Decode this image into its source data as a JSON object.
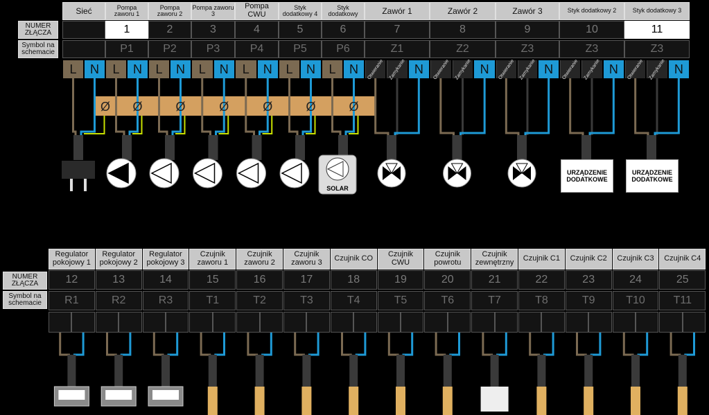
{
  "top": {
    "row_label_number": "NUMER ZŁĄCZA",
    "row_label_symbol": "Symbol na schemacie",
    "columns": [
      {
        "header": "Sieć",
        "number": "",
        "symbol": "",
        "terminals": [
          "L",
          "N"
        ]
      },
      {
        "header": "Pompa zaworu 1",
        "number": "1",
        "symbol": "P1",
        "terminals": [
          "L",
          "N"
        ]
      },
      {
        "header": "Pompa zaworu 2",
        "number": "2",
        "symbol": "P2",
        "terminals": [
          "L",
          "N"
        ]
      },
      {
        "header": "Pompa zaworu 3",
        "number": "3",
        "symbol": "P3",
        "terminals": [
          "L",
          "N"
        ]
      },
      {
        "header": "Pompa CWU",
        "number": "4",
        "symbol": "P4",
        "terminals": [
          "L",
          "N"
        ]
      },
      {
        "header": "Styk dodatkowy 4",
        "number": "5",
        "symbol": "P5",
        "terminals": [
          "L",
          "N"
        ]
      },
      {
        "header": "Styk dodatkowy",
        "number": "6",
        "symbol": "P6",
        "terminals": [
          "L",
          "N"
        ]
      },
      {
        "header": "Zawór 1",
        "number": "7",
        "symbol": "Z1",
        "terminals": [
          "Otwieranie",
          "Zamykanie",
          "N"
        ]
      },
      {
        "header": "Zawór 2",
        "number": "8",
        "symbol": "Z2",
        "terminals": [
          "Otwieranie",
          "Zamykanie",
          "N"
        ]
      },
      {
        "header": "Zawór 3",
        "number": "9",
        "symbol": "Z3",
        "terminals": [
          "Otwieranie",
          "Zamykanie",
          "N"
        ]
      },
      {
        "header": "Styk dodatkowy 2",
        "number": "10",
        "symbol": "Z3",
        "terminals": [
          "Otwieranie",
          "Zamykanie",
          "N"
        ]
      },
      {
        "header": "Styk dodatkowy 3",
        "number": "11",
        "symbol": "Z3",
        "terminals": [
          "Otwieranie",
          "Zamykanie",
          "N"
        ]
      }
    ],
    "highlighted_numbers": [
      "1",
      "11"
    ],
    "fuse_symbol": "Ø",
    "devices": [
      {
        "kind": "plug-icon"
      },
      {
        "kind": "pump-icon"
      },
      {
        "kind": "pump-icon"
      },
      {
        "kind": "pump-icon"
      },
      {
        "kind": "pump-icon"
      },
      {
        "kind": "pump-icon"
      },
      {
        "kind": "solar-pump-icon",
        "label": "SOLAR"
      },
      {
        "kind": "valve-icon"
      },
      {
        "kind": "valve-icon"
      },
      {
        "kind": "valve-icon"
      },
      {
        "kind": "device-box",
        "label": "URZĄDZENIE DODATKOWE"
      },
      {
        "kind": "device-box",
        "label": "URZĄDZENIE DODATKOWE"
      }
    ]
  },
  "bottom": {
    "row_label_number": "NUMER ZŁĄCZA",
    "row_label_symbol": "Symbol na schemacie",
    "columns": [
      {
        "header": "Regulator pokojowy 1",
        "number": "12",
        "symbol": "R1",
        "device": "room-regulator"
      },
      {
        "header": "Regulator pokojowy 2",
        "number": "13",
        "symbol": "R2",
        "device": "room-regulator"
      },
      {
        "header": "Regulator pokojowy 3",
        "number": "14",
        "symbol": "R3",
        "device": "room-regulator"
      },
      {
        "header": "Czujnik zaworu 1",
        "number": "15",
        "symbol": "T1",
        "device": "temp-sensor"
      },
      {
        "header": "Czujnik zaworu 2",
        "number": "16",
        "symbol": "T2",
        "device": "temp-sensor"
      },
      {
        "header": "Czujnik zaworu 3",
        "number": "17",
        "symbol": "T3",
        "device": "temp-sensor"
      },
      {
        "header": "Czujnik CO",
        "number": "18",
        "symbol": "T4",
        "device": "temp-sensor"
      },
      {
        "header": "Czujnik CWU",
        "number": "19",
        "symbol": "T5",
        "device": "temp-sensor"
      },
      {
        "header": "Czujnik powrotu",
        "number": "20",
        "symbol": "T6",
        "device": "temp-sensor"
      },
      {
        "header": "Czujnik zewnętrzny",
        "number": "21",
        "symbol": "T7",
        "device": "outdoor-sensor"
      },
      {
        "header": "Czujnik C1",
        "number": "22",
        "symbol": "T8",
        "device": "temp-sensor"
      },
      {
        "header": "Czujnik C2",
        "number": "23",
        "symbol": "T9",
        "device": "temp-sensor"
      },
      {
        "header": "Czujnik C3",
        "number": "24",
        "symbol": "T10",
        "device": "temp-sensor"
      },
      {
        "header": "Czujnik C4",
        "number": "25",
        "symbol": "T11",
        "device": "temp-sensor"
      }
    ]
  },
  "colors": {
    "live": "#7b6a52",
    "neutral": "#1e9ad6",
    "earth": "#c8e000",
    "fuse_bar": "#d4a060",
    "sensor_probe": "#e0b060"
  }
}
